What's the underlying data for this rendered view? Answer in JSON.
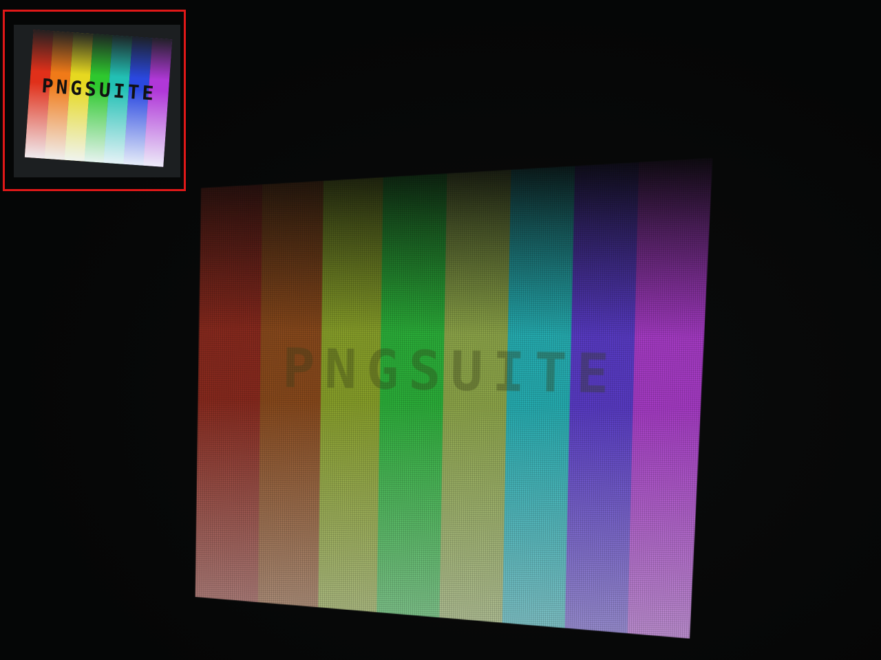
{
  "thumbnail": {
    "label": "PNGSUITE",
    "frame_color": "#e01818",
    "bar_colors": [
      "#e0301a",
      "#f07a18",
      "#e6d820",
      "#2ec82e",
      "#22c0b4",
      "#2a48e0",
      "#b038d8"
    ]
  },
  "main_image": {
    "bar_colors": [
      "#8a2a1e",
      "#8a4a1c",
      "#8aa22a",
      "#2cb23a",
      "#8fa84a",
      "#26b0b4",
      "#5a3cc8",
      "#a83cc8"
    ]
  }
}
